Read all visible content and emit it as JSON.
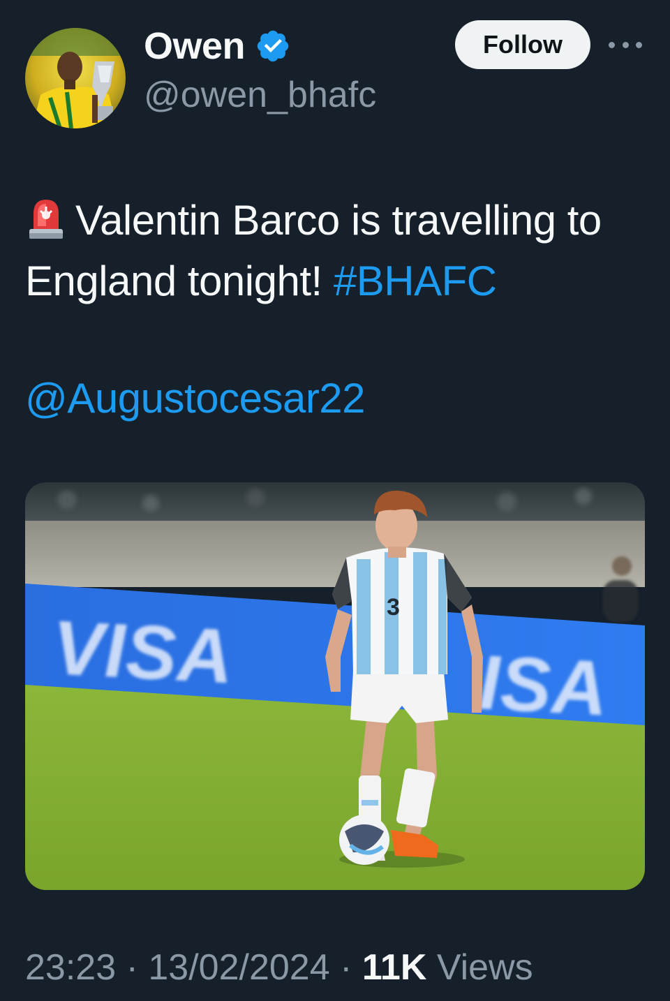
{
  "author": {
    "display_name": "Owen",
    "handle": "@owen_bhafc",
    "verified": true,
    "avatar": "avatar-player-with-trophy"
  },
  "actions": {
    "follow_label": "Follow",
    "more_icon": "more-dots-icon"
  },
  "tweet": {
    "emoji": "siren-icon",
    "text": "Valentin Barco is travelling to England tonight!",
    "hashtag": "#BHAFC",
    "mention": "@Augustocesar22",
    "media": {
      "description_icon": "football-player-photo",
      "ad_board_text_left": "VISA",
      "ad_board_text_right": "ISA",
      "shirt_number": "3"
    }
  },
  "meta": {
    "time": "23:23",
    "sep1": "·",
    "date": "13/02/2024",
    "sep2": "·",
    "views_count": "11K",
    "views_label": "Views"
  },
  "colors": {
    "background": "#15202b",
    "text": "#f7f9f9",
    "secondary": "#8b98a5",
    "link": "#1d9bf0",
    "verified": "#1d9bf0",
    "follow_bg": "#eff3f4"
  }
}
